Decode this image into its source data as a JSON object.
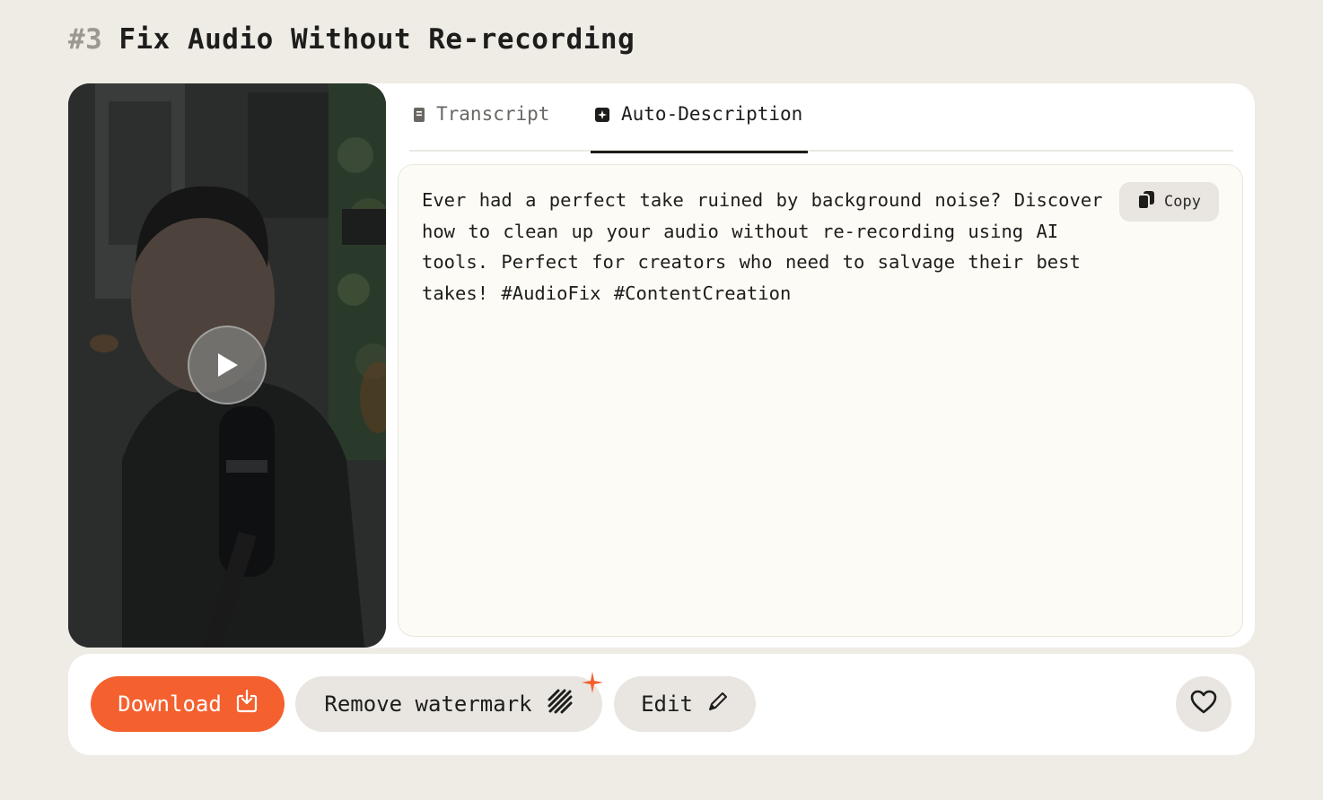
{
  "header": {
    "number": "#3",
    "title": "Fix Audio Without Re-recording"
  },
  "video": {
    "play_icon": "play-icon"
  },
  "tabs": [
    {
      "label": "Transcript",
      "icon": "document-icon",
      "active": false
    },
    {
      "label": "Auto-Description",
      "icon": "sparkle-square-icon",
      "active": true
    }
  ],
  "description": {
    "text": "Ever had a perfect take ruined by background noise? Discover how to clean up your audio without re-recording using AI tools. Perfect for creators who need to salvage their best takes! #AudioFix #ContentCreation",
    "copy_label": "Copy"
  },
  "actions": {
    "download_label": "Download",
    "remove_watermark_label": "Remove watermark",
    "edit_label": "Edit"
  },
  "colors": {
    "accent": "#f5602f",
    "background": "#efebe5",
    "chip": "#e9e6e1"
  }
}
